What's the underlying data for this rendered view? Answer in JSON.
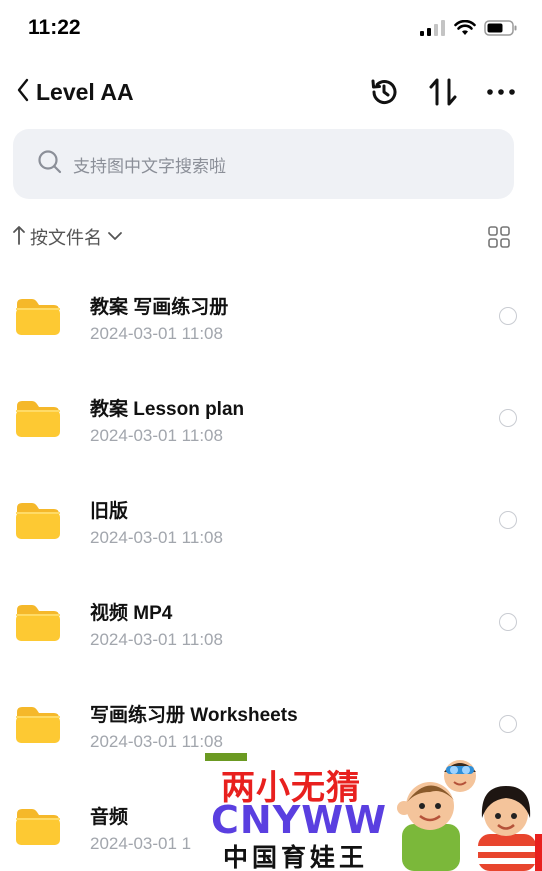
{
  "status_bar": {
    "time": "11:22"
  },
  "nav": {
    "title": "Level AA"
  },
  "search": {
    "placeholder": "支持图中文字搜索啦"
  },
  "sort": {
    "label": "按文件名"
  },
  "files": [
    {
      "name": "教案 写画练习册",
      "date": "2024-03-01 11:08"
    },
    {
      "name": "教案 Lesson plan",
      "date": "2024-03-01 11:08"
    },
    {
      "name": "旧版",
      "date": "2024-03-01 11:08"
    },
    {
      "name": "视频 MP4",
      "date": "2024-03-01 11:08"
    },
    {
      "name": "写画练习册 Worksheets",
      "date": "2024-03-01 11:08"
    },
    {
      "name": "音频",
      "date": "2024-03-01 1"
    }
  ],
  "watermark": {
    "line1": "两小无猜",
    "line2": "CNYWW",
    "line3": "中国育娃王"
  },
  "colors": {
    "folder": "#fdc933",
    "watermark_red": "#e8201e",
    "watermark_purple": "#5a3fe0"
  }
}
